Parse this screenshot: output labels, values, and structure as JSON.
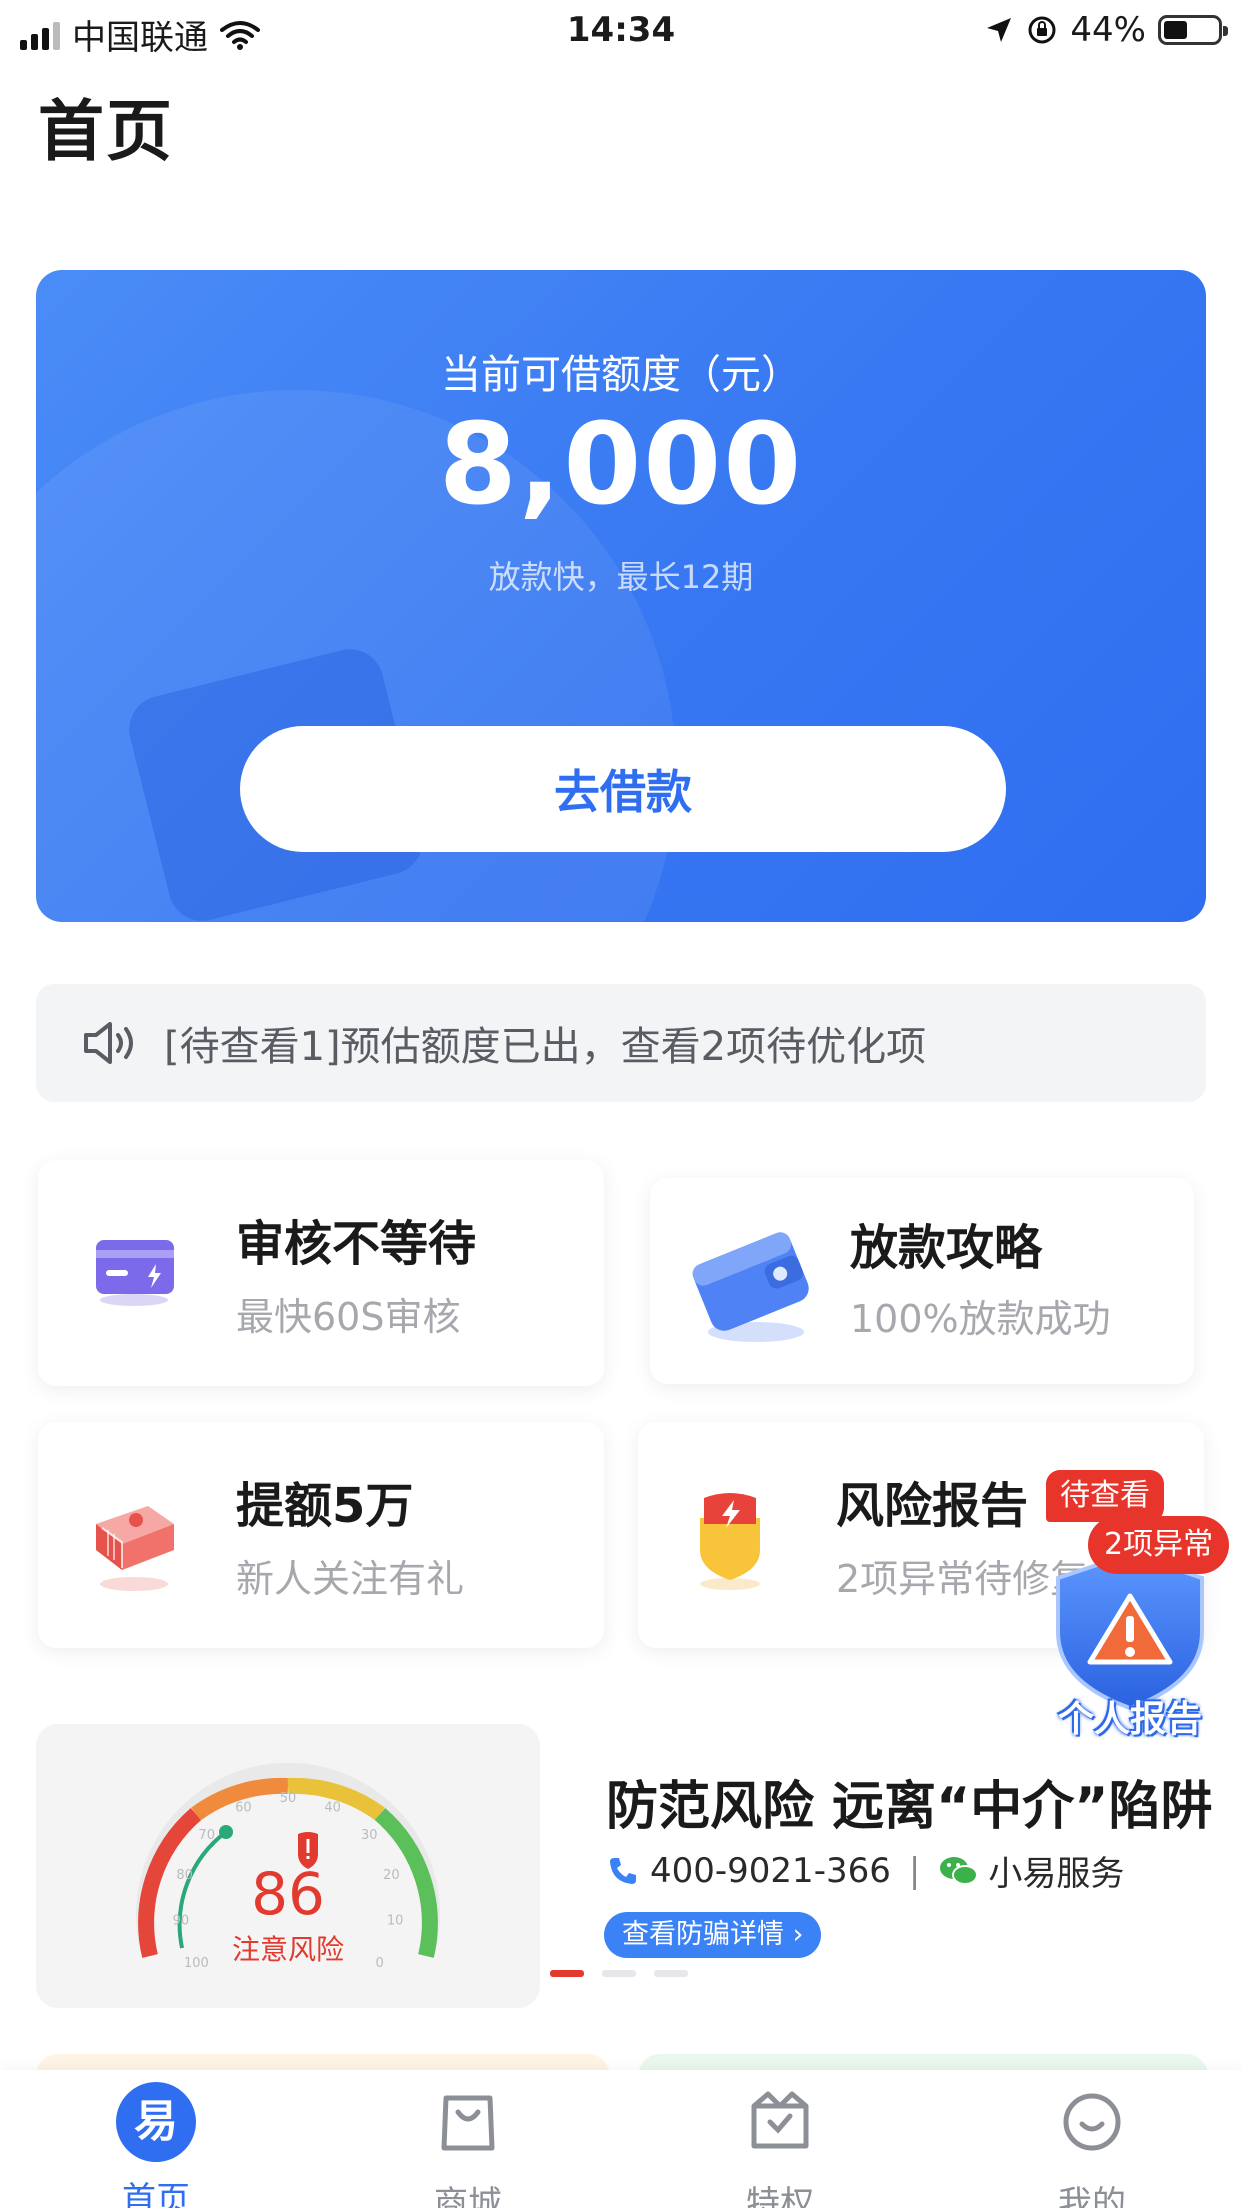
{
  "status_bar": {
    "carrier": "中国联通",
    "time": "14:34",
    "battery": "44%",
    "battery_level": 0.44
  },
  "page": {
    "title": "首页"
  },
  "hero": {
    "label": "当前可借额度（元）",
    "amount": "8,000",
    "subtitle": "放款快，最长12期",
    "button_label": "去借款"
  },
  "notice": {
    "icon": "speaker-icon",
    "text": "[待查看1]预估额度已出，查看2项待优化项"
  },
  "features": [
    {
      "title": "审核不等待",
      "subtitle": "最快60S审核",
      "icon": "card-icon"
    },
    {
      "title": "放款攻略",
      "subtitle": "100%放款成功",
      "icon": "wallet-icon"
    },
    {
      "title": "提额5万",
      "subtitle": "新人关注有礼",
      "icon": "money-stack-icon"
    },
    {
      "title": "风险报告",
      "subtitle": "2项异常待修复",
      "icon": "shield-bolt-icon",
      "badge": "待查看"
    }
  ],
  "floating_report": {
    "badge": "2项异常",
    "label": "个人报告",
    "icon": "warning-shield-icon"
  },
  "risk_banner": {
    "score": "86",
    "score_label": "注意风险",
    "gauge_ticks": [
      "100",
      "90",
      "80",
      "70",
      "60",
      "50",
      "40",
      "30",
      "20",
      "10",
      "0"
    ],
    "title": "防范风险  远离“中介”陷阱",
    "phone": "400-9021-366",
    "separator": "|",
    "service": "小易服务",
    "detail_button": "查看防骗详情",
    "carousel_total": 3,
    "carousel_active": 1
  },
  "tabbar": {
    "tabs": [
      {
        "label": "首页",
        "icon": "home-logo-icon",
        "active": true,
        "logo_char": "易"
      },
      {
        "label": "商城",
        "icon": "shopping-bag-icon",
        "active": false
      },
      {
        "label": "特权",
        "icon": "privilege-bag-icon",
        "active": false
      },
      {
        "label": "我的",
        "icon": "smiley-icon",
        "active": false
      }
    ]
  },
  "colors": {
    "primary": "#2f6ef0",
    "danger": "#e8352b",
    "notice_bg": "#f3f4f6"
  }
}
